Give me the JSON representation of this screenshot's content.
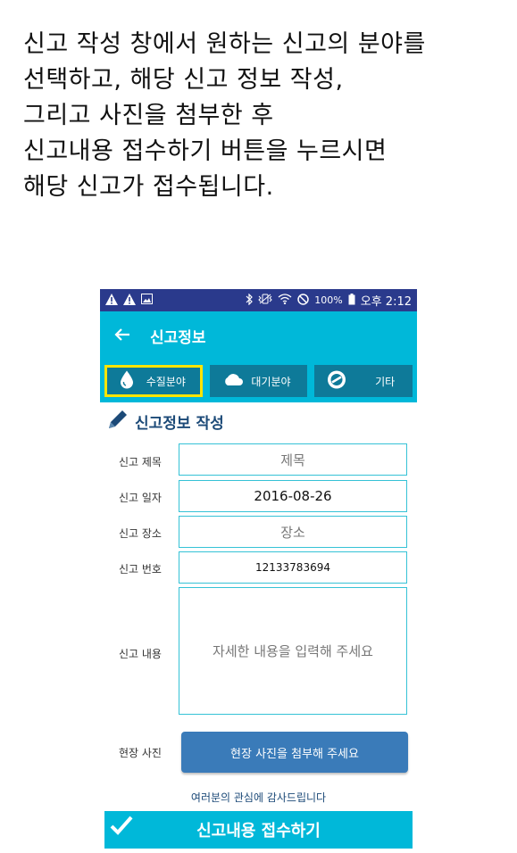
{
  "instructions": [
    "신고 작성 창에서 원하는 신고의 분야를",
    "선택하고, 해당 신고 정보 작성,",
    "그리고 사진을 첨부한 후",
    "신고내용 접수하기 버튼을 누르시면",
    "해당 신고가 접수됩니다."
  ],
  "status_bar": {
    "battery": "100%",
    "time": "오후 2:12"
  },
  "app_bar": {
    "title": "신고정보"
  },
  "tabs": [
    {
      "label": "수질분야",
      "icon": "water-drop-icon",
      "active": true
    },
    {
      "label": "대기분야",
      "icon": "cloud-icon",
      "active": false
    },
    {
      "label": "기타",
      "icon": "no-entry-icon",
      "active": false
    }
  ],
  "form": {
    "section_title": "신고정보 작성",
    "title_label": "신고 제목",
    "title_placeholder": "제목",
    "date_label": "신고 일자",
    "date_value": "2016-08-26",
    "location_label": "신고 장소",
    "location_placeholder": "장소",
    "number_label": "신고 번호",
    "number_value": "12133783694",
    "content_label": "신고 내용",
    "content_placeholder": "자세한 내용을 입력해 주세요",
    "photo_label": "현장 사진",
    "photo_button": "현장 사진을 첨부해 주세요"
  },
  "thanks": "여러분의 관심에 감사드립니다",
  "submit_label": "신고내용 접수하기",
  "colors": {
    "accent": "#00b8d9",
    "tab_bg": "#0e7a99",
    "status_bar": "#2a3a8c",
    "active_border": "#ffe500",
    "button": "#3a7bb9",
    "heading": "#1c4a78"
  }
}
